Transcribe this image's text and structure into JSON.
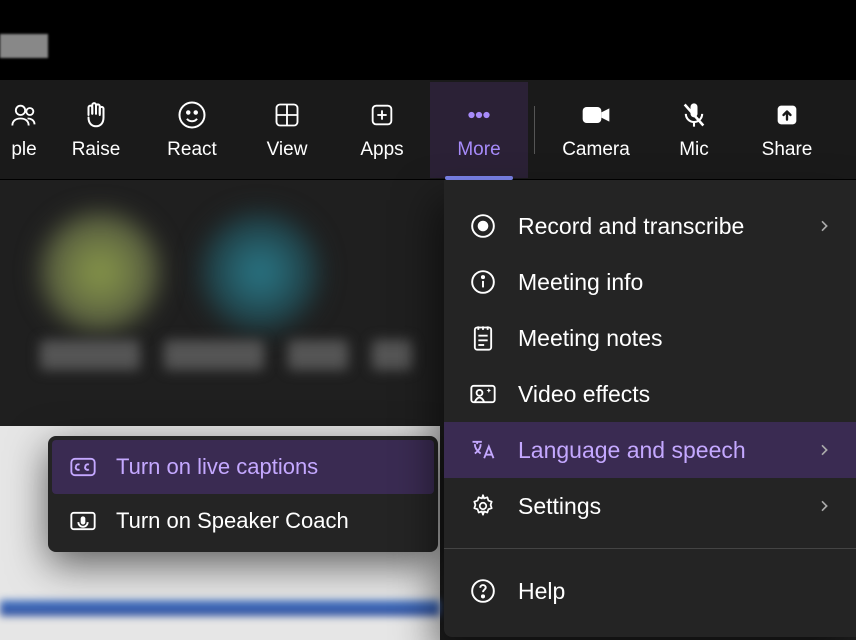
{
  "toolbar": {
    "people": "ple",
    "raise": "Raise",
    "react": "React",
    "view": "View",
    "apps": "Apps",
    "more": "More",
    "camera": "Camera",
    "mic": "Mic",
    "share": "Share"
  },
  "more_menu": {
    "record": "Record and transcribe",
    "meeting_info": "Meeting info",
    "meeting_notes": "Meeting notes",
    "video_effects": "Video effects",
    "language_speech": "Language and speech",
    "settings": "Settings",
    "help": "Help"
  },
  "submenu": {
    "live_captions": "Turn on live captions",
    "speaker_coach": "Turn on Speaker Coach"
  },
  "colors": {
    "accent": "#a78bfa",
    "highlight_bg": "#3a2b52",
    "panel_bg": "#242424"
  }
}
